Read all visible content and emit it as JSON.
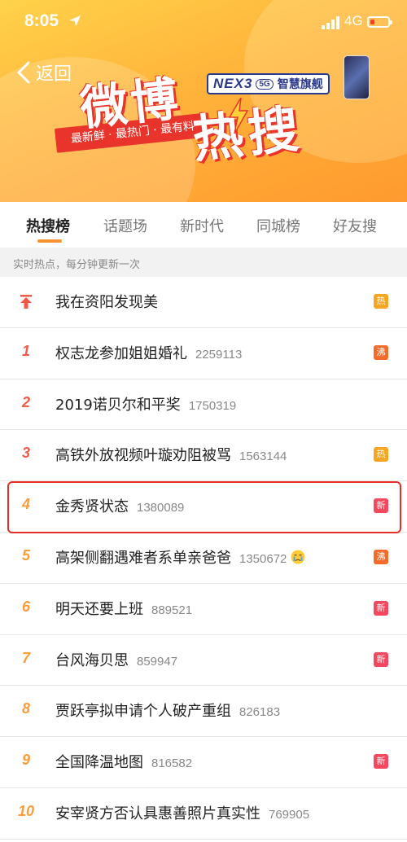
{
  "status_bar": {
    "time": "8:05",
    "network": "4G"
  },
  "header": {
    "back_label": "返回",
    "logo_line1": "微博",
    "logo_line2": "热搜",
    "slogan": "最新鲜 · 最热门 · 最有料",
    "ad": {
      "brand": "NEX3",
      "badge": "5G",
      "text": "智慧旗舰"
    }
  },
  "tabs": [
    {
      "label": "热搜榜",
      "active": true
    },
    {
      "label": "话题场",
      "active": false
    },
    {
      "label": "新时代",
      "active": false
    },
    {
      "label": "同城榜",
      "active": false
    },
    {
      "label": "好友搜",
      "active": false
    }
  ],
  "subheader": "实时热点，每分钟更新一次",
  "items": [
    {
      "rank": "",
      "title": "我在资阳发现美",
      "count": "",
      "badge": "热",
      "badge_type": "hot",
      "pinned": true
    },
    {
      "rank": "1",
      "title": "权志龙参加姐姐婚礼",
      "count": "2259113",
      "badge": "沸",
      "badge_type": "boil"
    },
    {
      "rank": "2",
      "title": "2019诺贝尔和平奖",
      "count": "1750319",
      "badge": "",
      "badge_type": ""
    },
    {
      "rank": "3",
      "title": "高铁外放视频叶璇劝阻被骂",
      "count": "1563144",
      "badge": "热",
      "badge_type": "hot"
    },
    {
      "rank": "4",
      "title": "金秀贤状态",
      "count": "1380089",
      "badge": "新",
      "badge_type": "new"
    },
    {
      "rank": "5",
      "title": "高架侧翻遇难者系单亲爸爸",
      "count": "1350672",
      "badge": "沸",
      "badge_type": "boil",
      "emoji": "crying-face-icon"
    },
    {
      "rank": "6",
      "title": "明天还要上班",
      "count": "889521",
      "badge": "新",
      "badge_type": "new"
    },
    {
      "rank": "7",
      "title": "台风海贝思",
      "count": "859947",
      "badge": "新",
      "badge_type": "new"
    },
    {
      "rank": "8",
      "title": "贾跃亭拟申请个人破产重组",
      "count": "826183",
      "badge": "",
      "badge_type": ""
    },
    {
      "rank": "9",
      "title": "全国降温地图",
      "count": "816582",
      "badge": "新",
      "badge_type": "new"
    },
    {
      "rank": "10",
      "title": "安宰贤方否认具惠善照片真实性",
      "count": "769905",
      "badge": "",
      "badge_type": ""
    }
  ],
  "highlight_rank": "4"
}
